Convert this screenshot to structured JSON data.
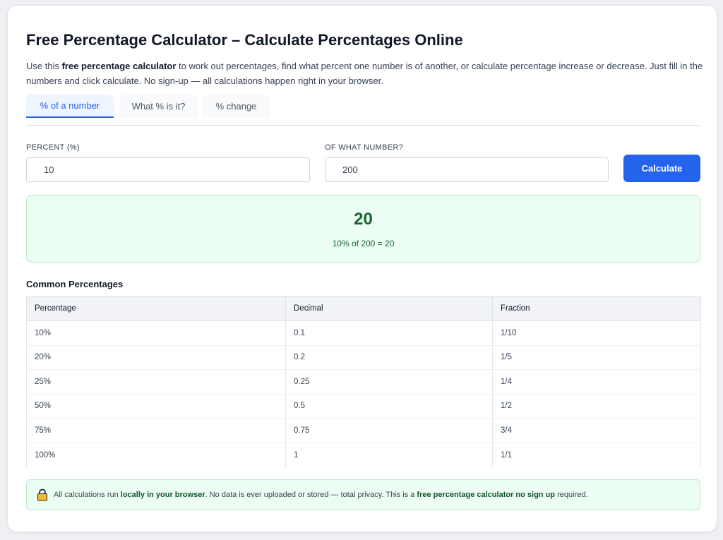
{
  "page": {
    "title": "Free Percentage Calculator – Calculate Percentages Online",
    "intro": {
      "p1": "Use this ",
      "bold": "free percentage calculator",
      "p2": " to work out percentages, find what percent one number is of another, or calculate percentage increase or decrease. Just fill in the numbers and click calculate. No sign-up — all calculations happen right in your browser."
    }
  },
  "tabs": [
    {
      "label": "% of a number",
      "active": true
    },
    {
      "label": "What % is it?",
      "active": false
    },
    {
      "label": "% change",
      "active": false
    }
  ],
  "form": {
    "percent_label": "PERCENT (%)",
    "percent_value": "10",
    "number_label": "OF WHAT NUMBER?",
    "number_value": "200",
    "calculate_label": "Calculate"
  },
  "result": {
    "value": "20",
    "expression": "10% of 200 = 20"
  },
  "table": {
    "title": "Common Percentages",
    "headers": [
      "Percentage",
      "Decimal",
      "Fraction"
    ],
    "rows": [
      [
        "10%",
        "0.1",
        "1/10"
      ],
      [
        "20%",
        "0.2",
        "1/5"
      ],
      [
        "25%",
        "0.25",
        "1/4"
      ],
      [
        "50%",
        "0.5",
        "1/2"
      ],
      [
        "75%",
        "0.75",
        "3/4"
      ],
      [
        "100%",
        "1",
        "1/1"
      ]
    ]
  },
  "privacy": {
    "icon": "lock-icon",
    "t1": "All calculations run ",
    "b1": "locally in your browser",
    "t2": ". No data is ever uploaded or stored — total privacy. This is a ",
    "b2": "free percentage calculator no sign up",
    "t3": " required."
  },
  "colors": {
    "accent": "#2563eb",
    "success_bg": "#ecfdf3",
    "success_text": "#166534"
  }
}
